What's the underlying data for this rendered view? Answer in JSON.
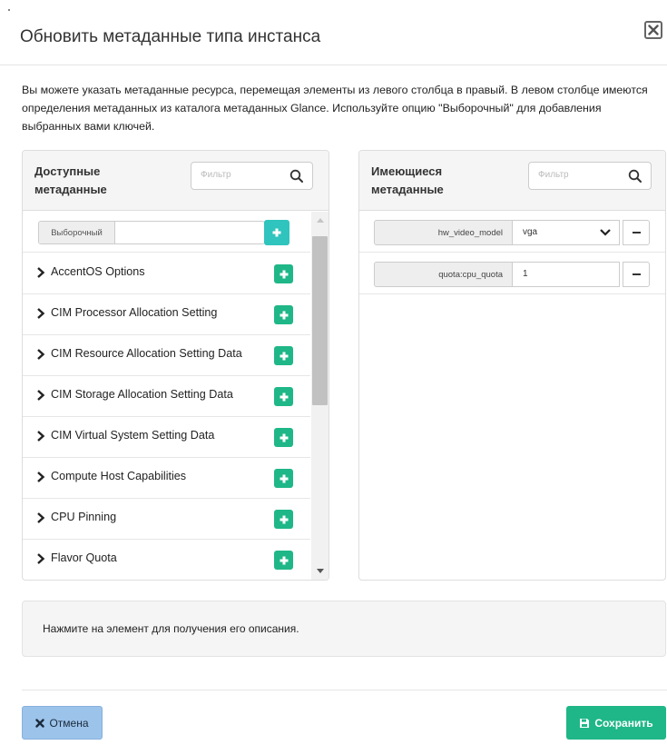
{
  "header": {
    "title": "Обновить метаданные типа инстанса",
    "close_icon": "close-icon"
  },
  "intro": "Вы можете указать метаданные ресурса, перемещая элементы из левого столбца в правый. В левом столбце имеются определения метаданных из каталога метаданных Glance. Используйте опцию \"Выборочный\" для добавления выбранных вами ключей.",
  "available": {
    "heading": "Доступные метаданные",
    "filter_placeholder": "Фильтр",
    "custom_label": "Выборочный",
    "custom_value": "",
    "items": [
      {
        "label": "AccentOS Options"
      },
      {
        "label": "CIM Processor Allocation Setting"
      },
      {
        "label": "CIM Resource Allocation Setting Data"
      },
      {
        "label": "CIM Storage Allocation Setting Data"
      },
      {
        "label": "CIM Virtual System Setting Data"
      },
      {
        "label": "Compute Host Capabilities"
      },
      {
        "label": "CPU Pinning"
      },
      {
        "label": "Flavor Quota"
      }
    ]
  },
  "existing": {
    "heading": "Имеющиеся метаданные",
    "filter_placeholder": "Фильтр",
    "items": [
      {
        "key": "hw_video_model",
        "value": "vga",
        "type": "select"
      },
      {
        "key": "quota:cpu_quota",
        "value": "1",
        "type": "text"
      }
    ]
  },
  "description": "Нажмите на элемент для получения его описания.",
  "footer": {
    "cancel_label": "Отмена",
    "save_label": "Сохранить"
  },
  "colors": {
    "accent_green": "#1fb787",
    "custom_add": "#2fc4bd",
    "cancel_bg": "#9cc3ea"
  }
}
